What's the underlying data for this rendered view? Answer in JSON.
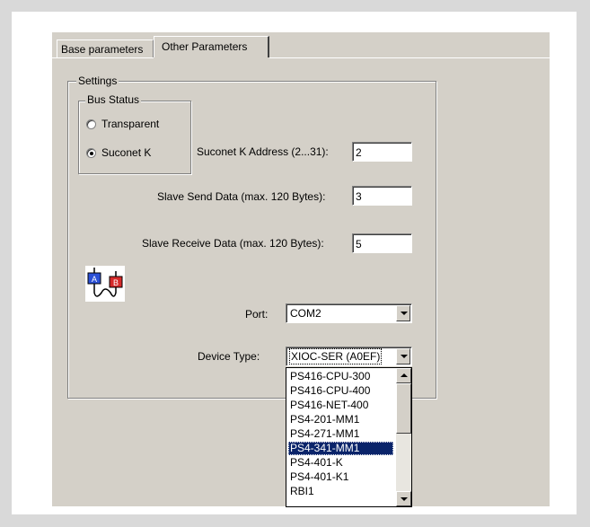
{
  "tabs": [
    {
      "label": "Base parameters",
      "active": false
    },
    {
      "label": "Other Parameters",
      "active": true
    }
  ],
  "settings": {
    "group_title": "Settings",
    "bus_status": {
      "group_title": "Bus Status",
      "options": [
        {
          "label": "Transparent",
          "selected": false
        },
        {
          "label": "Suconet K",
          "selected": true
        }
      ]
    },
    "suconet_address": {
      "label": "Suconet K Address (2...31):",
      "value": "2"
    },
    "slave_send": {
      "label": "Slave Send Data (max. 120 Bytes):",
      "value": "3"
    },
    "slave_receive": {
      "label": "Slave Receive Data (max. 120 Bytes):",
      "value": "5"
    },
    "port": {
      "label": "Port:",
      "value": "COM2"
    },
    "device_type": {
      "label": "Device Type:",
      "value": "XIOC-SER (A0EF)",
      "list_items": [
        "PS416-CPU-300",
        "PS416-CPU-400",
        "PS416-NET-400",
        "PS4-201-MM1",
        "PS4-271-MM1",
        "PS4-341-MM1",
        "PS4-401-K",
        "PS4-401-K1",
        "RBI1"
      ],
      "highlighted_item": "PS4-341-MM1"
    }
  },
  "icons": {
    "connection": "connection-ab-icon"
  },
  "colors": {
    "dialog_bg": "#d4d0c8",
    "selection_bg": "#0a246a",
    "page_bg": "#d9d9d9"
  }
}
